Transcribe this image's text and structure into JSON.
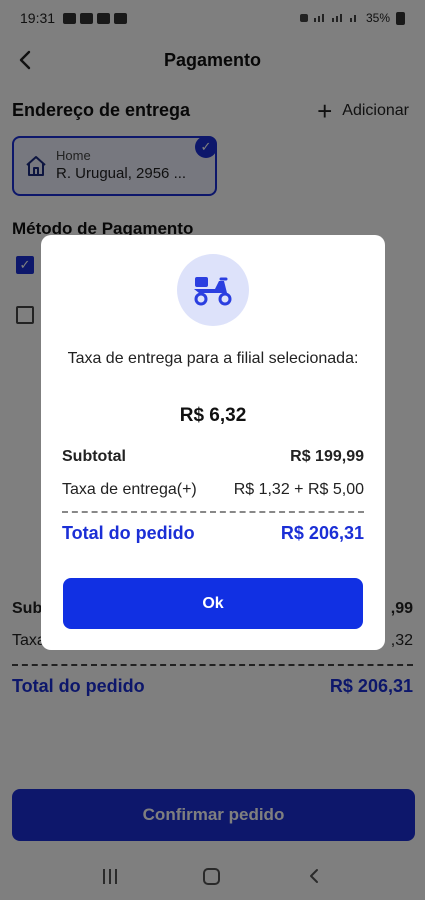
{
  "status_bar": {
    "time": "19:31",
    "battery": "35%"
  },
  "header": {
    "title": "Pagamento",
    "back_icon": "chevron-left-icon"
  },
  "address": {
    "section_title": "Endereço de entrega",
    "add_label": "Adicionar",
    "card": {
      "label": "Home",
      "value": "R. Urugual, 2956 ..."
    }
  },
  "payment": {
    "section_title": "Método de Pagamento"
  },
  "summary_bg": {
    "subtotal_label": "Sub",
    "subtotal_value": ",99",
    "fee_label": "Taxa",
    "fee_value": ",32",
    "total_label": "Total do pedido",
    "total_value": "R$ 206,31"
  },
  "confirm_button": "Confirmar pedido",
  "modal": {
    "icon": "delivery-scooter-icon",
    "message": "Taxa de entrega para a filial selecionada:",
    "fee": "R$ 6,32",
    "subtotal_label": "Subtotal",
    "subtotal_value": "R$ 199,99",
    "fee_row_label": "Taxa de entrega(+)",
    "fee_row_value": "R$ 1,32 + R$ 5,00",
    "total_label": "Total do pedido",
    "total_value": "R$ 206,31",
    "ok_button": "Ok"
  },
  "colors": {
    "primary": "#1b2fd6",
    "ok_button": "#1130e3",
    "icon_circle": "#dde2fa"
  }
}
